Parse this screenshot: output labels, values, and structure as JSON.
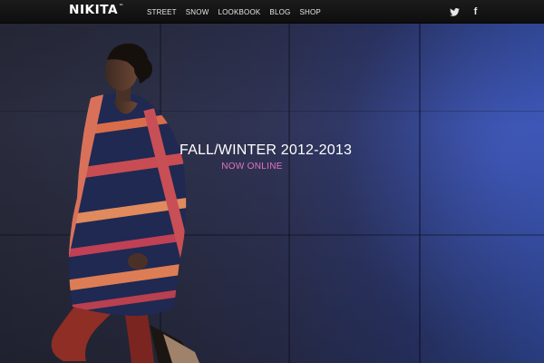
{
  "brand": {
    "logo_text": "NIKITA",
    "tm": "™"
  },
  "nav": {
    "items": [
      {
        "label": "STREET"
      },
      {
        "label": "SNOW"
      },
      {
        "label": "LOOKBOOK"
      },
      {
        "label": "BLOG"
      },
      {
        "label": "SHOP"
      }
    ]
  },
  "social": {
    "twitter_icon": "twitter-icon",
    "facebook_icon": "facebook-icon",
    "facebook_glyph": "f"
  },
  "hero": {
    "title": "FALL/WINTER 2012-2013",
    "subtitle": "NOW ONLINE",
    "subtitle_color": "#e472c4",
    "image_description": "model-in-striped-dress"
  },
  "colors": {
    "topbar": "#141414",
    "wall_left": "#2a2c3e",
    "wall_right": "#3550a8"
  }
}
